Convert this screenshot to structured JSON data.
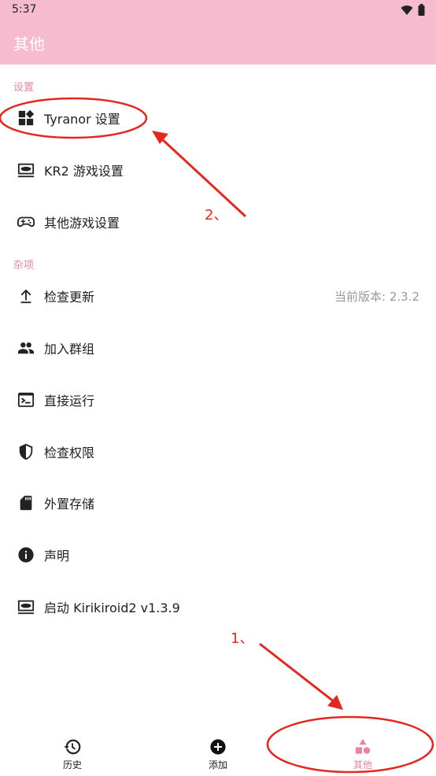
{
  "status_bar": {
    "time": "5:37",
    "icons": [
      "wifi-icon",
      "battery-icon"
    ]
  },
  "app_bar": {
    "title": "其他"
  },
  "sections": {
    "settings": {
      "header": "设置",
      "items": [
        {
          "label": "Tyranor 设置",
          "icon": "widgets-icon"
        },
        {
          "label": "KR2 游戏设置",
          "icon": "game-console-icon"
        },
        {
          "label": "其他游戏设置",
          "icon": "gamepad-icon"
        }
      ]
    },
    "misc": {
      "header": "杂项",
      "items": [
        {
          "label": "检查更新",
          "icon": "upload-arrow-icon",
          "trailing": "当前版本: 2.3.2"
        },
        {
          "label": "加入群组",
          "icon": "group-icon"
        },
        {
          "label": "直接运行",
          "icon": "terminal-icon"
        },
        {
          "label": "检查权限",
          "icon": "shield-icon"
        },
        {
          "label": "外置存储",
          "icon": "sd-card-icon"
        },
        {
          "label": "声明",
          "icon": "info-icon"
        },
        {
          "label": "启动 Kirikiroid2 v1.3.9",
          "icon": "game-console-icon"
        }
      ]
    }
  },
  "bottom_nav": {
    "items": [
      {
        "label": "历史",
        "icon": "history-icon",
        "active": false
      },
      {
        "label": "添加",
        "icon": "add-circle-icon",
        "active": false
      },
      {
        "label": "其他",
        "icon": "shapes-icon",
        "active": true
      }
    ]
  },
  "annotations": {
    "label_1": "1、",
    "label_2": "2、",
    "color": "#e5281f"
  },
  "colors": {
    "accent": "#f7bbd0",
    "accent_text": "#e783a6"
  }
}
